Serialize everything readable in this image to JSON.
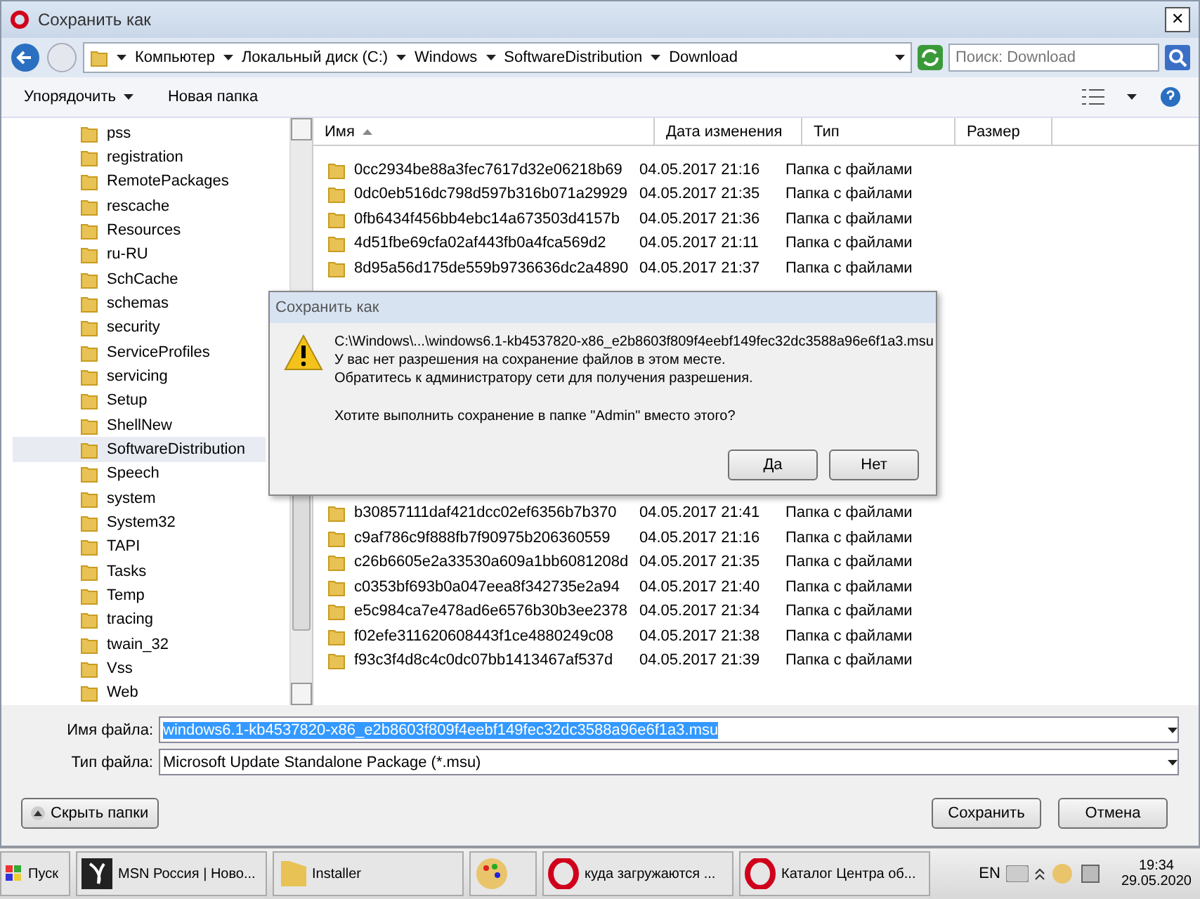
{
  "window": {
    "title": "Сохранить как",
    "close": "✕"
  },
  "address": {
    "crumbs": [
      "Компьютер",
      "Локальный диск (C:)",
      "Windows",
      "SoftwareDistribution",
      "Download"
    ]
  },
  "search": {
    "placeholder": "Поиск: Download"
  },
  "toolbar": {
    "organize": "Упорядочить",
    "new_folder": "Новая папка"
  },
  "sidebar": {
    "items": [
      {
        "label": "pss",
        "selected": false
      },
      {
        "label": "registration",
        "selected": false
      },
      {
        "label": "RemotePackages",
        "selected": false
      },
      {
        "label": "rescache",
        "selected": false
      },
      {
        "label": "Resources",
        "selected": false
      },
      {
        "label": "ru-RU",
        "selected": false
      },
      {
        "label": "SchCache",
        "selected": false
      },
      {
        "label": "schemas",
        "selected": false
      },
      {
        "label": "security",
        "selected": false
      },
      {
        "label": "ServiceProfiles",
        "selected": false
      },
      {
        "label": "servicing",
        "selected": false
      },
      {
        "label": "Setup",
        "selected": false
      },
      {
        "label": "ShellNew",
        "selected": false
      },
      {
        "label": "SoftwareDistribution",
        "selected": true
      },
      {
        "label": "Speech",
        "selected": false
      },
      {
        "label": "system",
        "selected": false
      },
      {
        "label": "System32",
        "selected": false
      },
      {
        "label": "TAPI",
        "selected": false
      },
      {
        "label": "Tasks",
        "selected": false
      },
      {
        "label": "Temp",
        "selected": false
      },
      {
        "label": "tracing",
        "selected": false
      },
      {
        "label": "twain_32",
        "selected": false
      },
      {
        "label": "Vss",
        "selected": false
      },
      {
        "label": "Web",
        "selected": false
      }
    ]
  },
  "table": {
    "columns": [
      "Имя",
      "Дата изменения",
      "Тип",
      "Размер"
    ],
    "rows_above": [
      {
        "name": "0cc2934be88a3fec7617d32e06218b69",
        "date": "04.05.2017 21:16",
        "type": "Папка с файлами"
      },
      {
        "name": "0dc0eb516dc798d597b316b071a29929",
        "date": "04.05.2017 21:35",
        "type": "Папка с файлами"
      },
      {
        "name": "0fb6434f456bb4ebc14a673503d4157b",
        "date": "04.05.2017 21:36",
        "type": "Папка с файлами"
      },
      {
        "name": "4d51fbe69cfa02af443fb0a4fca569d2",
        "date": "04.05.2017 21:11",
        "type": "Папка с файлами"
      },
      {
        "name": "8d95a56d175de559b9736636dc2a4890",
        "date": "04.05.2017 21:37",
        "type": "Папка с файлами"
      }
    ],
    "rows_below": [
      {
        "name": "b30857111daf421dcc02ef6356b7b370",
        "date": "04.05.2017 21:41",
        "type": "Папка с файлами"
      },
      {
        "name": "c9af786c9f888fb7f90975b206360559",
        "date": "04.05.2017 21:16",
        "type": "Папка с файлами"
      },
      {
        "name": "c26b6605e2a33530a609a1bb6081208d",
        "date": "04.05.2017 21:35",
        "type": "Папка с файлами"
      },
      {
        "name": "c0353bf693b0a047eea8f342735e2a94",
        "date": "04.05.2017 21:40",
        "type": "Папка с файлами"
      },
      {
        "name": "e5c984ca7e478ad6e6576b30b3ee2378",
        "date": "04.05.2017 21:34",
        "type": "Папка с файлами"
      },
      {
        "name": "f02efe311620608443f1ce4880249c08",
        "date": "04.05.2017 21:38",
        "type": "Папка с файлами"
      },
      {
        "name": "f93c3f4d8c4c0dc07bb1413467af537d",
        "date": "04.05.2017 21:39",
        "type": "Папка с файлами"
      }
    ]
  },
  "file_name": {
    "label": "Имя файла:",
    "value": "windows6.1-kb4537820-x86_e2b8603f809f4eebf149fec32dc3588a96e6f1a3.msu"
  },
  "file_type": {
    "label": "Тип файла:",
    "value": "Microsoft Update Standalone Package (*.msu)"
  },
  "hide_folders": "Скрыть папки",
  "buttons": {
    "save": "Сохранить",
    "cancel": "Отмена"
  },
  "dialog": {
    "title": "Сохранить как",
    "path": "C:\\Windows\\...\\windows6.1-kb4537820-x86_e2b8603f809f4eebf149fec32dc3588a96e6f1a3.msu",
    "message": "У вас нет разрешения на сохранение файлов в этом месте.",
    "hint": "Обратитесь к администратору сети для получения разрешения.",
    "question": "Хотите выполнить сохранение в папке \"Admin\" вместо этого?",
    "yes": "Да",
    "no": "Нет"
  },
  "taskbar": {
    "start": "Пуск",
    "tasks": [
      {
        "label": "MSN Россия | Ново...",
        "kind": "msn"
      },
      {
        "label": "Installer",
        "kind": "folder"
      },
      {
        "kind": "paint"
      },
      {
        "label": "куда загружаются ...",
        "kind": "opera"
      },
      {
        "label": "Каталог Центра об...",
        "kind": "opera"
      }
    ],
    "lang": "EN",
    "time": "19:34",
    "date": "29.05.2020"
  }
}
